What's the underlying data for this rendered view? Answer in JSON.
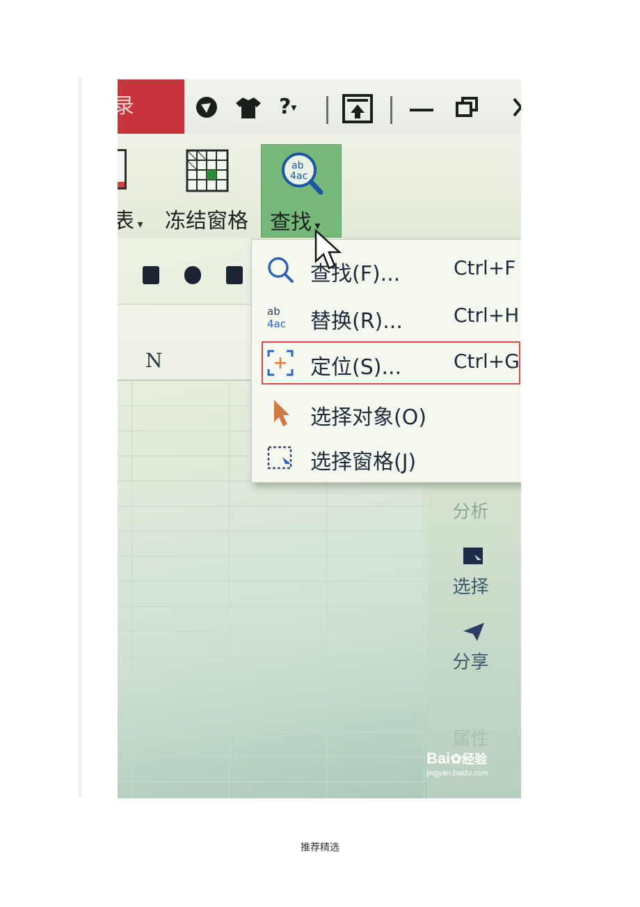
{
  "titlebar": {
    "login_label": "录",
    "help_label": "?",
    "icons": [
      "skin-icon",
      "shirt-icon",
      "help-icon",
      "upload-icon",
      "minimize-icon",
      "restore-icon",
      "close-icon"
    ]
  },
  "ribbon": {
    "table_label": "表",
    "freeze_label": "冻结窗格",
    "find_label": "查找"
  },
  "sheet": {
    "column_n": "N"
  },
  "menu": {
    "items": [
      {
        "label": "查找(F)...",
        "shortcut": "Ctrl+F",
        "icon": "search-icon"
      },
      {
        "label": "替换(R)...",
        "shortcut": "Ctrl+H",
        "icon": "replace-icon"
      },
      {
        "label": "定位(S)...",
        "shortcut": "Ctrl+G",
        "icon": "locate-icon"
      },
      {
        "label": "选择对象(O)",
        "shortcut": "",
        "icon": "pointer-icon"
      },
      {
        "label": "选择窗格(J)",
        "shortcut": "",
        "icon": "pane-icon"
      }
    ],
    "highlighted_index": 2
  },
  "side_panel": {
    "items": [
      "分析",
      "选择",
      "分享",
      "属性"
    ]
  },
  "watermark": {
    "brand": "Bai",
    "brand_suffix": "经验",
    "url": "jingyan.baidu.com"
  },
  "footer": {
    "text": "推荐精选"
  },
  "colors": {
    "title_red": "#c8343b",
    "find_green": "#76b77a",
    "highlight_red": "#e0454a"
  }
}
